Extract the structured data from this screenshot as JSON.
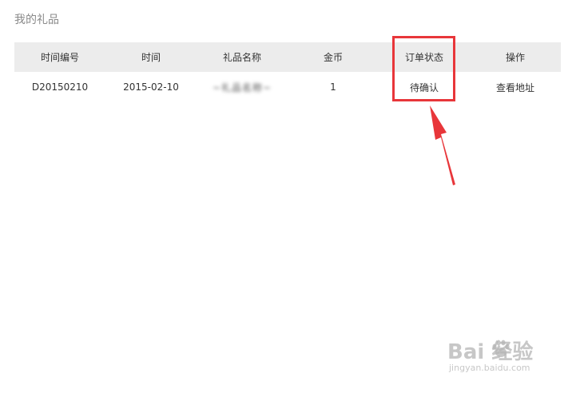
{
  "page": {
    "title": "我的礼品"
  },
  "table": {
    "headers": [
      "时间编号",
      "时间",
      "礼品名称",
      "金币",
      "订单状态",
      "操作"
    ],
    "rows": [
      {
        "order_id": "D20150210",
        "date": "2015-02-10",
        "gift_name": "~礼品名称~",
        "coins": "1",
        "status": "待确认",
        "action": "查看地址"
      }
    ]
  },
  "annotation": {
    "color": "#e8363a"
  },
  "watermark": {
    "main_text": "Bai 经验",
    "sub_text": "jingyan.baidu.com"
  }
}
